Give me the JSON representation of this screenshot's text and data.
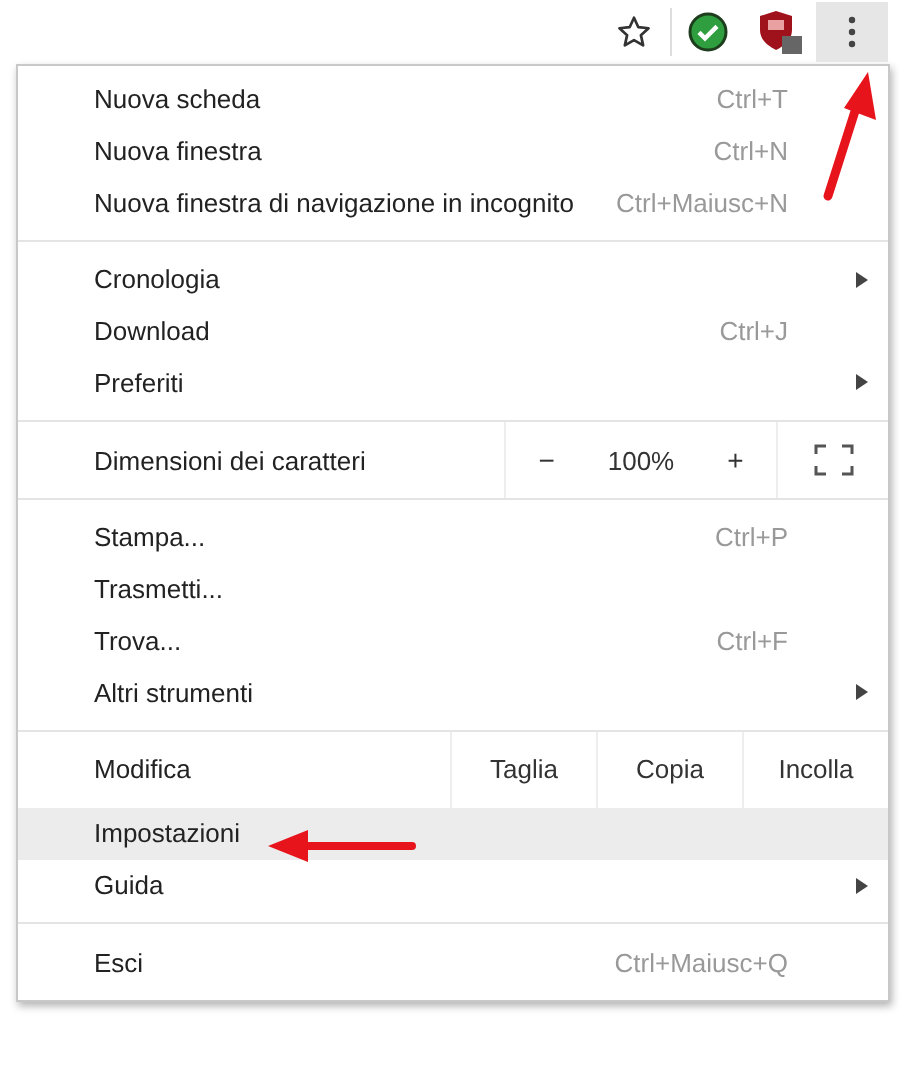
{
  "toolbar": {
    "icons": [
      {
        "kind": "star"
      },
      {
        "kind": "check"
      },
      {
        "kind": "shield"
      },
      {
        "kind": "menu",
        "selected": true
      }
    ]
  },
  "menu": {
    "sections": [
      {
        "items": [
          {
            "kind": "item",
            "label": "Nuova scheda",
            "shortcut": "Ctrl+T",
            "has_submenu": false,
            "selected": false
          },
          {
            "kind": "item",
            "label": "Nuova finestra",
            "shortcut": "Ctrl+N",
            "has_submenu": false,
            "selected": false
          },
          {
            "kind": "item",
            "label": "Nuova finestra di navigazione in incognito",
            "shortcut": "Ctrl+Maiusc+N",
            "has_submenu": false,
            "selected": false
          }
        ]
      },
      {
        "items": [
          {
            "kind": "item",
            "label": "Cronologia",
            "has_submenu": true,
            "selected": false
          },
          {
            "kind": "item",
            "label": "Download",
            "shortcut": "Ctrl+J",
            "has_submenu": false,
            "selected": false
          },
          {
            "kind": "item",
            "label": "Preferiti",
            "has_submenu": true,
            "selected": false
          }
        ]
      },
      {
        "items": [
          {
            "kind": "zoom",
            "label": "Dimensioni dei caratteri",
            "minus": "−",
            "value": "100%",
            "plus": "+"
          }
        ]
      },
      {
        "items": [
          {
            "kind": "item",
            "label": "Stampa...",
            "shortcut": "Ctrl+P",
            "has_submenu": false,
            "selected": false
          },
          {
            "kind": "item",
            "label": "Trasmetti...",
            "has_submenu": false,
            "selected": false
          },
          {
            "kind": "item",
            "label": "Trova...",
            "shortcut": "Ctrl+F",
            "has_submenu": false,
            "selected": false
          },
          {
            "kind": "item",
            "label": "Altri strumenti",
            "has_submenu": true,
            "selected": false
          }
        ]
      },
      {
        "items": [
          {
            "kind": "edit",
            "label": "Modifica",
            "buttons": [
              "Taglia",
              "Copia",
              "Incolla"
            ]
          },
          {
            "kind": "item",
            "label": "Impostazioni",
            "has_submenu": false,
            "selected": true
          },
          {
            "kind": "item",
            "label": "Guida",
            "has_submenu": true,
            "selected": false
          }
        ]
      },
      {
        "items": [
          {
            "kind": "item",
            "label": "Esci",
            "shortcut": "Ctrl+Maiusc+Q",
            "has_submenu": false,
            "selected": false
          }
        ]
      }
    ]
  }
}
